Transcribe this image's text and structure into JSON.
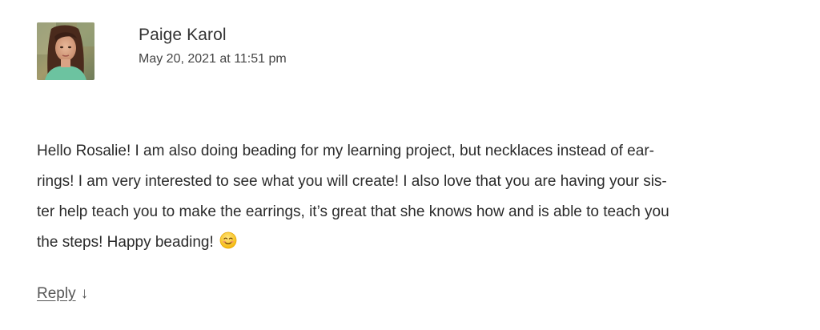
{
  "comment": {
    "author": "Paige Karol",
    "date": "May 20, 2021 at 11:51 pm",
    "avatar_icon": "user-photo",
    "body_lines": [
      "Hello Rosalie! I am also doing beading for my learning project, but necklaces instead of ear-",
      "rings! I am very interested to see what you will create! I also love that you are having your sis-",
      "ter help teach you to make the earrings, it’s great that she knows how and is able to teach you",
      "the steps! Happy beading!"
    ],
    "emoji": "smiling-face-emoji",
    "reply_label": "Reply",
    "reply_arrow": "↓"
  }
}
